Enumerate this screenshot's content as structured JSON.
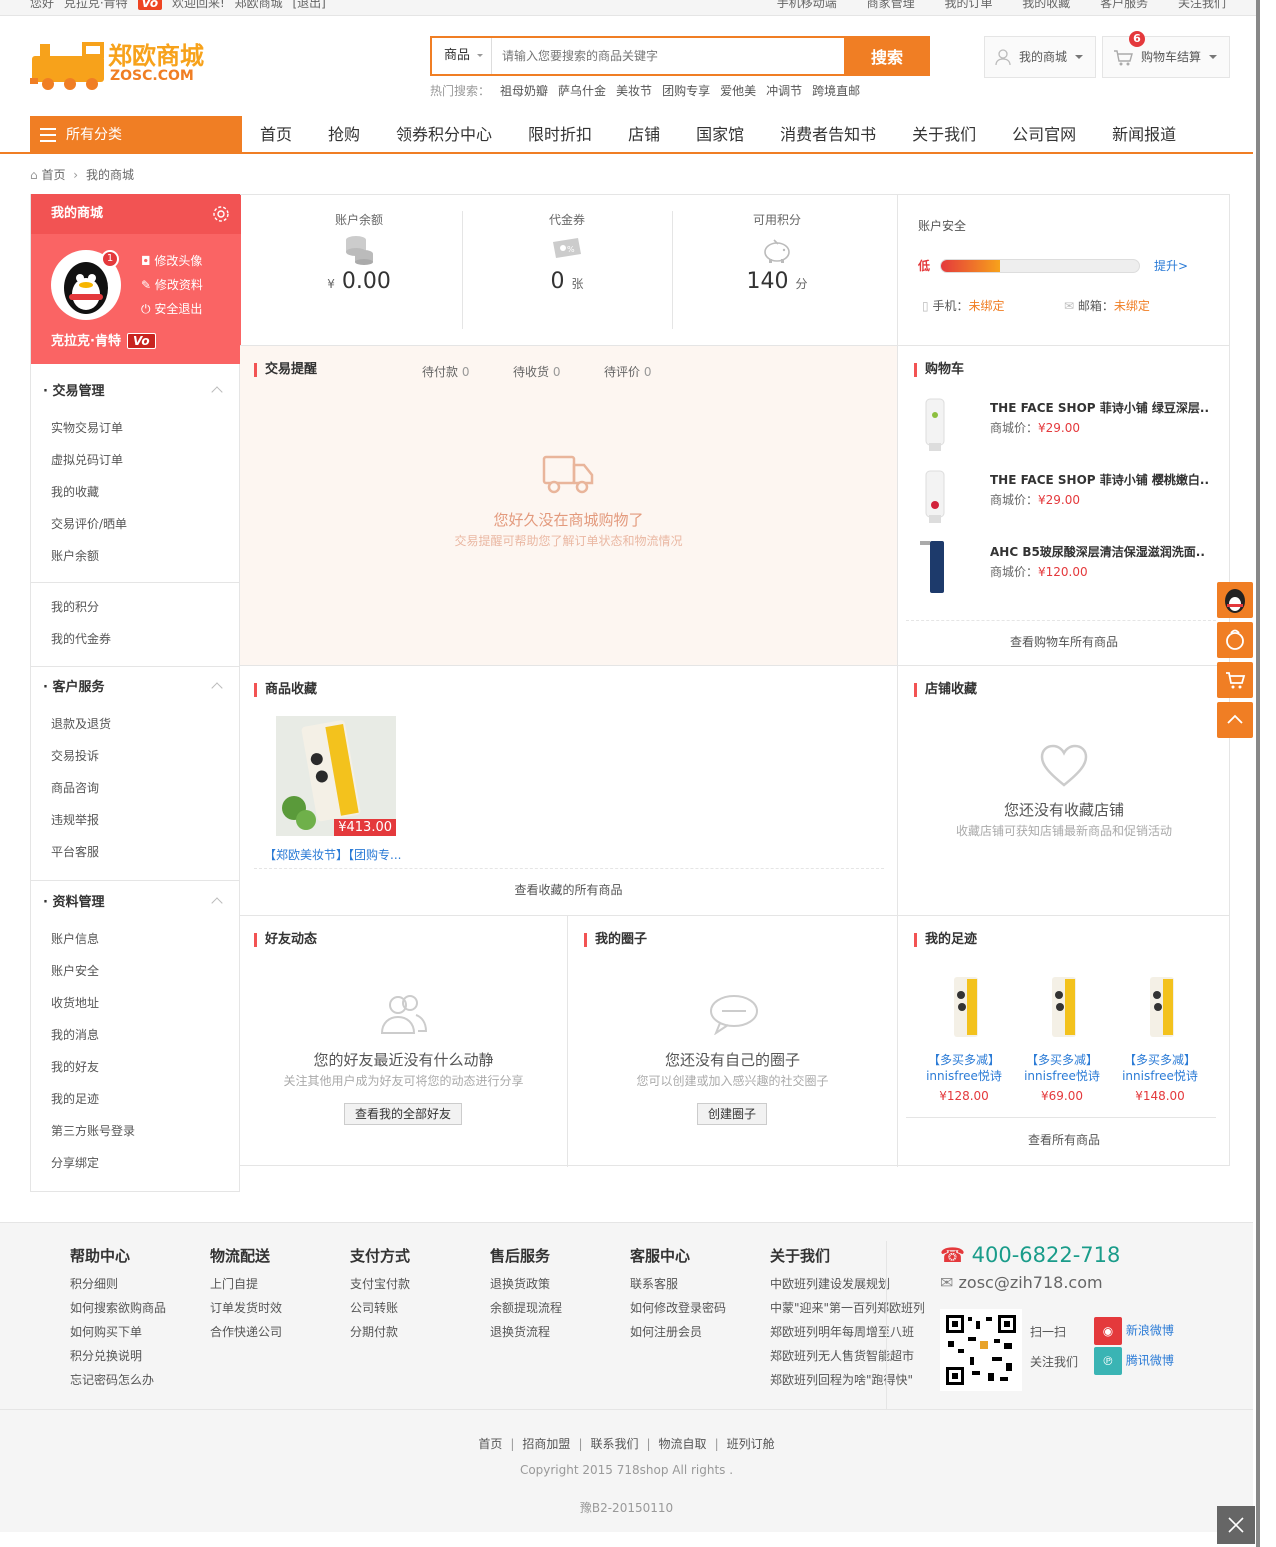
{
  "topbar": {
    "left_items": [
      "您好",
      "克拉克·肯特",
      "Vo",
      "欢迎回来!",
      "郑欧商城",
      "[退出]"
    ],
    "right_items": [
      "手机移动端",
      "商家管理",
      "我的订单",
      "我的收藏",
      "客户服务",
      "关注我们"
    ]
  },
  "header": {
    "logo_title": "郑欧商城",
    "logo_sub": "ZOSC.COM",
    "search_category": "商品",
    "search_placeholder": "请输入您要搜索的商品关键字",
    "search_button": "搜索",
    "hot_label": "热门搜索：",
    "hot_items": [
      "祖母奶瓣",
      "萨乌什金",
      "美妆节",
      "团购专享",
      "爱他美",
      "冲调节",
      "跨境直邮"
    ],
    "my_mall": "我的商城",
    "cart": "购物车结算",
    "cart_count": "6"
  },
  "nav": {
    "all_categories": "所有分类",
    "links": [
      "首页",
      "抢购",
      "领券积分中心",
      "限时折扣",
      "店铺",
      "国家馆",
      "消费者告知书",
      "关于我们",
      "公司官网",
      "新闻报道"
    ]
  },
  "breadcrumb": {
    "home": "首页",
    "current": "我的商城"
  },
  "sidebar": {
    "title": "我的商城",
    "notify_count": "1",
    "actions": [
      "修改头像",
      "修改资料",
      "安全退出"
    ],
    "username": "克拉克·肯特",
    "level": "Vo",
    "groups": [
      {
        "title": "交易管理",
        "items": [
          "实物交易订单",
          "虚拟兑码订单",
          "我的收藏",
          "交易评价/晒单",
          "账户余额"
        ]
      },
      {
        "title": "",
        "items": [
          "我的积分",
          "我的代金券"
        ]
      },
      {
        "title": "客户服务",
        "items": [
          "退款及退货",
          "交易投诉",
          "商品咨询",
          "违规举报",
          "平台客服"
        ]
      },
      {
        "title": "资料管理",
        "items": [
          "账户信息",
          "账户安全",
          "收货地址",
          "我的消息",
          "我的好友",
          "我的足迹",
          "第三方账号登录",
          "分享绑定"
        ]
      }
    ]
  },
  "stats": {
    "balance_label": "账户余额",
    "balance_currency": "¥",
    "balance_value": "0.00",
    "coupon_label": "代金券",
    "coupon_value": "0",
    "coupon_unit": "张",
    "points_label": "可用积分",
    "points_value": "140",
    "points_unit": "分"
  },
  "security": {
    "title": "账户安全",
    "level": "低",
    "level_pct": 0.3,
    "improve": "提升>",
    "phone_label": "手机：",
    "phone_status": "未绑定",
    "email_label": "邮箱：",
    "email_status": "未绑定"
  },
  "trade": {
    "title": "交易提醒",
    "tabs": [
      {
        "label": "待付款",
        "count": "0"
      },
      {
        "label": "待收货",
        "count": "0"
      },
      {
        "label": "待评价",
        "count": "0"
      }
    ],
    "empty_title": "您好久没在商城购物了",
    "empty_sub": "交易提醒可帮助您了解订单状态和物流情况"
  },
  "cart": {
    "title": "购物车",
    "price_label": "商城价：",
    "items": [
      {
        "name": "THE FACE SHOP 菲诗小铺 绿豆深层..",
        "price": "¥29.00"
      },
      {
        "name": "THE FACE SHOP 菲诗小铺 樱桃嫩白..",
        "price": "¥29.00"
      },
      {
        "name": "AHC B5玻尿酸深层清洁保湿滋润洗面..",
        "price": "¥120.00"
      }
    ],
    "view_all": "查看购物车所有商品"
  },
  "favorites": {
    "title": "商品收藏",
    "item_price": "¥413.00",
    "item_name": "【郑欧美妆节】【团购专...",
    "view_all": "查看收藏的所有商品"
  },
  "shops": {
    "title": "店铺收藏",
    "empty_title": "您还没有收藏店铺",
    "empty_sub": "收藏店铺可获知店铺最新商品和促销活动"
  },
  "friends": {
    "title": "好友动态",
    "empty_title": "您的好友最近没有什么动静",
    "empty_sub": "关注其他用户成为好友可将您的动态进行分享",
    "button": "查看我的全部好友"
  },
  "circles": {
    "title": "我的圈子",
    "empty_title": "您还没有自己的圈子",
    "empty_sub": "您可以创建或加入感兴趣的社交圈子",
    "button": "创建圈子"
  },
  "footprint": {
    "title": "我的足迹",
    "items": [
      {
        "tag": "【多买多减】",
        "name": "innisfree悦诗",
        "price": "¥128.00"
      },
      {
        "tag": "【多买多减】",
        "name": "innisfree悦诗",
        "price": "¥69.00"
      },
      {
        "tag": "【多买多减】",
        "name": "innisfree悦诗",
        "price": "¥148.00"
      }
    ],
    "view_all": "查看所有商品"
  },
  "footer": {
    "columns": [
      {
        "title": "帮助中心",
        "items": [
          "积分细则",
          "如何搜索欲购商品",
          "如何购买下单",
          "积分兑换说明",
          "忘记密码怎么办"
        ]
      },
      {
        "title": "物流配送",
        "items": [
          "上门自提",
          "订单发货时效",
          "合作快递公司"
        ]
      },
      {
        "title": "支付方式",
        "items": [
          "支付宝付款",
          "公司转账",
          "分期付款"
        ]
      },
      {
        "title": "售后服务",
        "items": [
          "退换货政策",
          "余额提现流程",
          "退换货流程"
        ]
      },
      {
        "title": "客服中心",
        "items": [
          "联系客服",
          "如何修改登录密码",
          "如何注册会员"
        ]
      },
      {
        "title": "关于我们",
        "items": [
          "中欧班列建设发展规划",
          "中蒙\"迎来\"第一百列郑欧班列",
          "郑欧班列明年每周增至八班",
          "郑欧班列无人售货智能超市",
          "郑欧班列回程为啥\"跑得快\""
        ]
      }
    ],
    "phone": "400-6822-718",
    "email": "zosc@zih718.com",
    "scan": "扫一扫",
    "follow": "关注我们",
    "weibo_sina": "新浪微博",
    "weibo_qq": "腾讯微博",
    "links": [
      "首页",
      "招商加盟",
      "联系我们",
      "物流自取",
      "班列订舱"
    ],
    "copyright": "Copyright 2015 718shop All rights .",
    "icp": "豫B2-20150110"
  },
  "colors": {
    "accent": "#f07e24",
    "red": "#f25353",
    "price": "#e4393c"
  }
}
